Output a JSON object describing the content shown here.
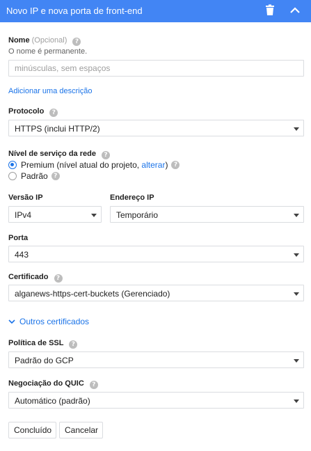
{
  "header": {
    "title": "Novo IP e nova porta de front-end"
  },
  "name": {
    "label": "Nome",
    "optional": "(Opcional)",
    "hint": "O nome é permanente.",
    "placeholder": "minúsculas, sem espaços",
    "value": ""
  },
  "add_description": "Adicionar uma descrição",
  "protocol": {
    "label": "Protocolo",
    "value": "HTTPS (inclui HTTP/2)"
  },
  "network_tier": {
    "label": "Nível de serviço da rede",
    "premium_label": "Premium (nível atual do projeto, ",
    "change_link": "alterar",
    "premium_suffix": ")",
    "standard_label": "Padrão",
    "selected": "premium"
  },
  "ip_version": {
    "label": "Versão IP",
    "value": "IPv4"
  },
  "ip_address": {
    "label": "Endereço IP",
    "value": "Temporário"
  },
  "port": {
    "label": "Porta",
    "value": "443"
  },
  "certificate": {
    "label": "Certificado",
    "value": "alganews-https-cert-buckets (Gerenciado)"
  },
  "other_certificates": "Outros certificados",
  "ssl_policy": {
    "label": "Política de SSL",
    "value": "Padrão do GCP"
  },
  "quic": {
    "label": "Negociação do QUIC",
    "value": "Automático (padrão)"
  },
  "buttons": {
    "done": "Concluído",
    "cancel": "Cancelar"
  },
  "help_glyph": "?",
  "colors": {
    "header_bg": "#4285f4",
    "link": "#1a73e8",
    "border": "#dadce0"
  }
}
